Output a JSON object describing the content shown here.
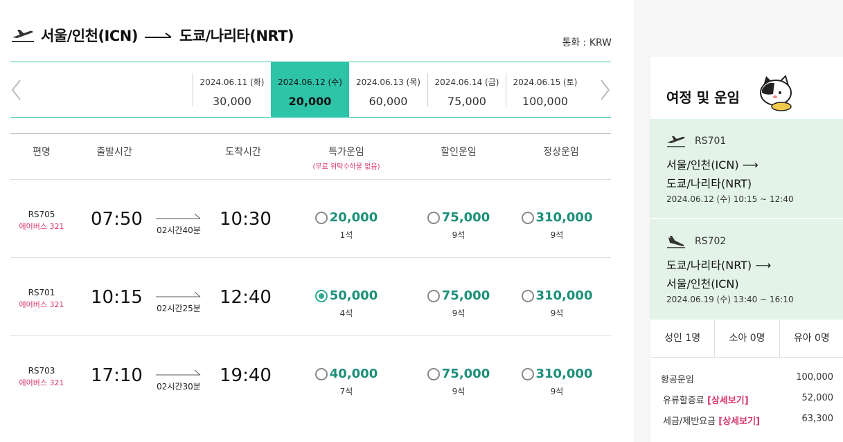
{
  "header": {
    "origin": "서울/인천(ICN)",
    "destination": "도쿄/나리타(NRT)",
    "currency": "통화 : KRW"
  },
  "dates": [
    {
      "date": "2024.06.11 (화)",
      "price": "30,000"
    },
    {
      "date": "2024.06.12 (수)",
      "price": "20,000",
      "selected": true
    },
    {
      "date": "2024.06.13 (목)",
      "price": "60,000"
    },
    {
      "date": "2024.06.14 (금)",
      "price": "75,000"
    },
    {
      "date": "2024.06.15 (토)",
      "price": "100,000"
    }
  ],
  "table": {
    "headers": {
      "flight": "편명",
      "depart": "출발시간",
      "arrive": "도착시간",
      "special": "특가운임",
      "special_note": "(무료 위탁수하물 없음)",
      "discount": "할인운임",
      "regular": "정상운임"
    },
    "rows": [
      {
        "flight": "RS705",
        "aircraft": "에어버스 321",
        "depart": "07:50",
        "duration": "02시간40분",
        "arrive": "10:30",
        "special": "20,000",
        "special_seats": "1석",
        "discount": "75,000",
        "discount_seats": "9석",
        "regular": "310,000",
        "regular_seats": "9석"
      },
      {
        "flight": "RS701",
        "aircraft": "에어버스 321",
        "depart": "10:15",
        "duration": "02시간25분",
        "arrive": "12:40",
        "special": "50,000",
        "special_seats": "4석",
        "discount": "75,000",
        "discount_seats": "9석",
        "regular": "310,000",
        "regular_seats": "9석"
      },
      {
        "flight": "RS703",
        "aircraft": "에어버스 321",
        "depart": "17:10",
        "duration": "02시간30분",
        "arrive": "19:40",
        "special": "40,000",
        "special_seats": "7석",
        "discount": "75,000",
        "discount_seats": "9석",
        "regular": "310,000",
        "regular_seats": "9석"
      }
    ]
  },
  "summary": {
    "title": "여정 및 운임",
    "outbound": {
      "flight": "RS701",
      "from": "서울/인천(ICN)",
      "to": "도쿄/나리타(NRT)",
      "datetime": "2024.06.12 (수) 10:15 ~ 12:40"
    },
    "inbound": {
      "flight": "RS702",
      "from": "도쿄/나리타(NRT)",
      "to": "서울/인천(ICN)",
      "datetime": "2024.06.19 (수) 13:40 ~ 16:10"
    },
    "pax": {
      "adult": "성인 1명",
      "child": "소아 0명",
      "infant": "유아 0명"
    },
    "costs": {
      "airfare_label": "항공운임",
      "airfare": "100,000",
      "fuel_label": "유류할증료",
      "fuel": "52,000",
      "tax_label": "세금/제반요금",
      "tax": "63,300",
      "detail_link": "[상세보기]"
    }
  },
  "colors": {
    "accent": "#2ec4a8",
    "fare_text": "#1d8f7a",
    "pink": "#d6336c",
    "segment_bg": "#e3f3e8"
  }
}
